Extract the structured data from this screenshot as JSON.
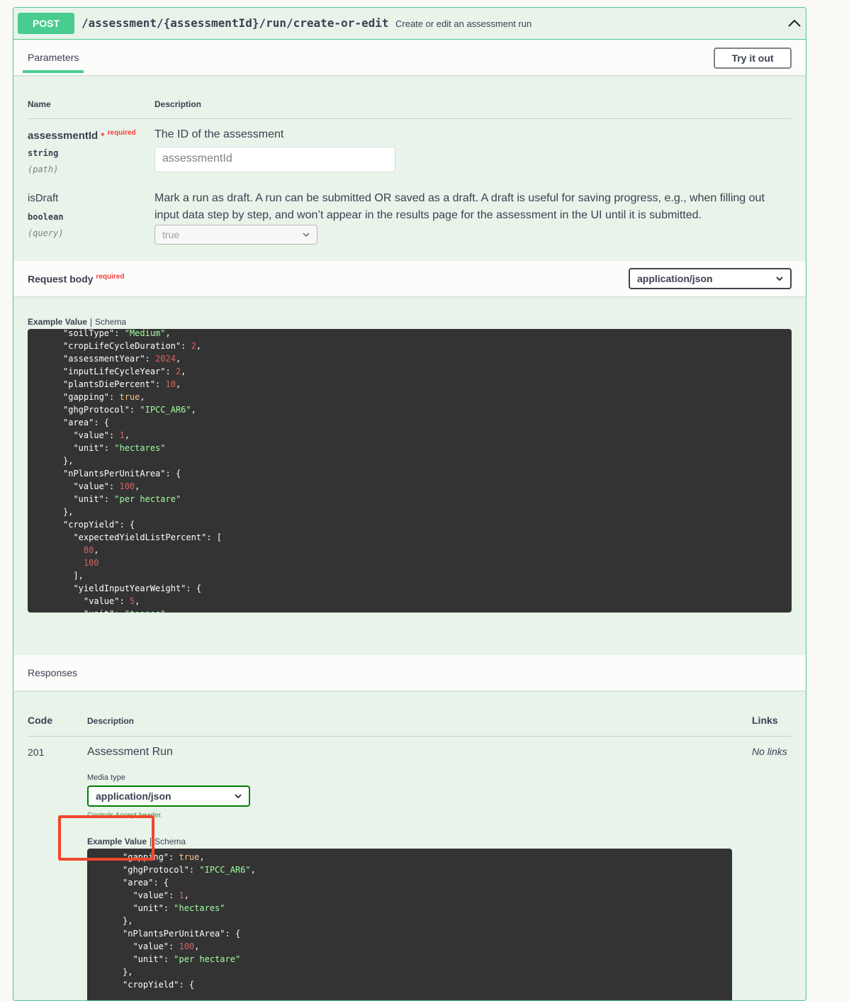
{
  "endpoint": {
    "method": "POST",
    "path": "/assessment/{assessmentId}/run/create-or-edit",
    "summary": "Create or edit an assessment run"
  },
  "parameters_section": {
    "tab_label": "Parameters",
    "try_button": "Try it out",
    "col_name": "Name",
    "col_description": "Description",
    "params": [
      {
        "name": "assessmentId",
        "required_star": "*",
        "required_text": "required",
        "type": "string",
        "in": "(path)",
        "description": "The ID of the assessment",
        "input_placeholder": "assessmentId"
      },
      {
        "name": "isDraft",
        "type": "boolean",
        "in": "(query)",
        "description_line1": "Mark a run as draft. A run can be submitted OR saved as a draft. A draft is useful for saving progress, e.g., when filling out",
        "description_line2": "input data step by step, and won’t appear in the results page for the assessment in the UI until it is submitted.",
        "select_value": "true"
      }
    ]
  },
  "request_body": {
    "label": "Request body",
    "required_text": "required",
    "content_type": "application/json",
    "tab_example": "Example Value",
    "tab_schema": "Schema"
  },
  "responses": {
    "label": "Responses",
    "col_code": "Code",
    "col_description": "Description",
    "col_links": "Links",
    "rows": [
      {
        "code": "201",
        "description": "Assessment Run",
        "links": "No links",
        "media_type_label": "Media type",
        "media_type": "application/json",
        "controls_note": "Controls Accept header.",
        "tab_example": "Example Value",
        "tab_schema": "Schema"
      }
    ]
  },
  "colors": {
    "post_green": "#49cc90",
    "panel_bg": "#e8f3ea",
    "code_bg": "#333333",
    "string_color": "#a2fca2",
    "number_color": "#d36363",
    "bool_color": "#fcc28c",
    "required_red": "#f93e3e",
    "highlight_red": "#f0462c"
  }
}
